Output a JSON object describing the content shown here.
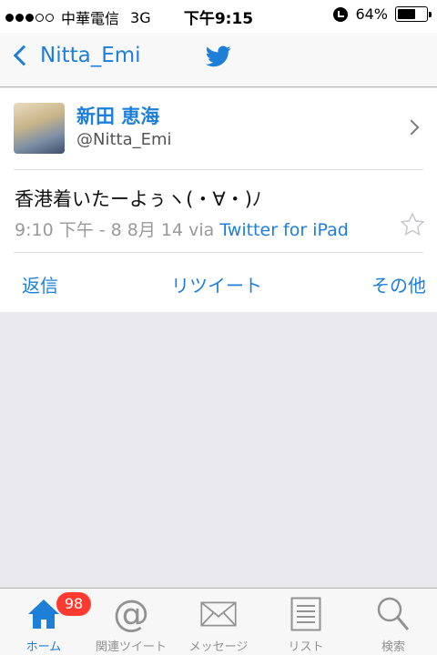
{
  "status_bar": {
    "carrier": "中華電信",
    "network": "3G",
    "time": "下午9:15",
    "battery": "64%",
    "battery_level": 0.64
  },
  "nav": {
    "back_label": "Nitta_Emi",
    "center_icon": "twitter-bird-icon"
  },
  "tweet": {
    "display_name": "新田 恵海",
    "screen_name": "@Nitta_Emi",
    "text": "香港着いたーよぅヽ(・∀・)ﾉ",
    "timestamp": "9:10 下午 - 8 8月 14 via",
    "via": "Twitter for iPad"
  },
  "actions": {
    "reply": "返信",
    "retweet": "リツイート",
    "other": "その他"
  },
  "tabs": {
    "home": "ホーム",
    "home_badge": "98",
    "related": "関連ツイート",
    "messages": "メッセージ",
    "lists": "リスト",
    "search": "検索"
  },
  "colors": {
    "accent": "#1e7fd8",
    "badge": "#ff3b30"
  }
}
